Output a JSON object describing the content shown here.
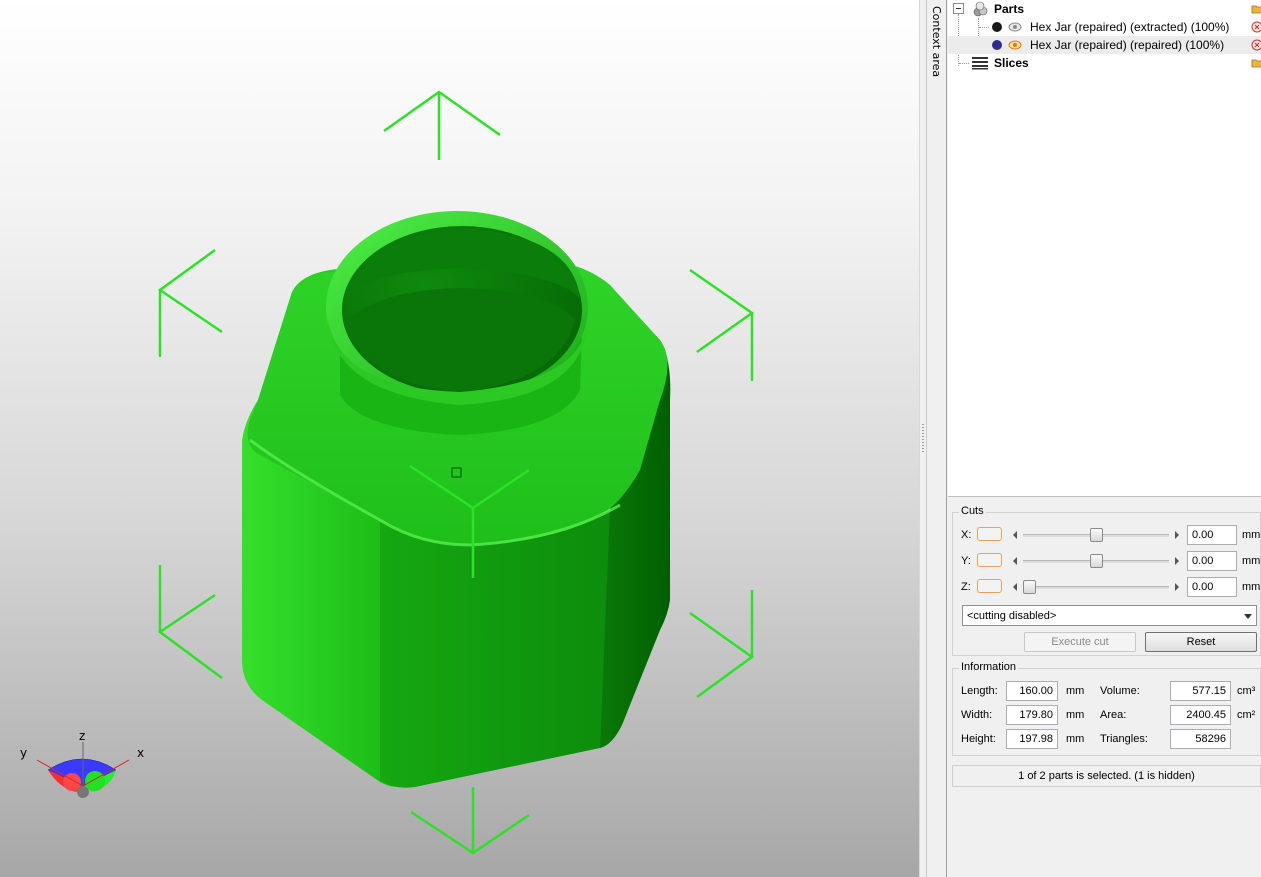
{
  "tree": {
    "parts_label": "Parts",
    "items": [
      {
        "label": "Hex Jar (repaired) (extracted) (100%)",
        "color": "#1a1a1a",
        "visible_icon": "eye-hidden-icon"
      },
      {
        "label": "Hex Jar (repaired) (repaired) (100%)",
        "color": "#2e2c8f",
        "visible_icon": "eye-visible-icon"
      }
    ],
    "slices_label": "Slices"
  },
  "context_label": "Context area",
  "viewport": {
    "model_color": "#1fce1a",
    "handle_color": "#22e01e",
    "axis_labels": {
      "x": "x",
      "y": "y",
      "z": "z"
    }
  },
  "cuts": {
    "title": "Cuts",
    "axes": [
      {
        "name": "X:",
        "value": "0.00",
        "unit": "mm",
        "position": 0.5
      },
      {
        "name": "Y:",
        "value": "0.00",
        "unit": "mm",
        "position": 0.5
      },
      {
        "name": "Z:",
        "value": "0.00",
        "unit": "mm",
        "position": 0.0
      }
    ],
    "mode": "<cutting disabled>",
    "execute_label": "Execute cut",
    "reset_label": "Reset"
  },
  "information": {
    "title": "Information",
    "length_label": "Length:",
    "length_value": "160.00",
    "length_unit": "mm",
    "width_label": "Width:",
    "width_value": "179.80",
    "width_unit": "mm",
    "height_label": "Height:",
    "height_value": "197.98",
    "height_unit": "mm",
    "volume_label": "Volume:",
    "volume_value": "577.15",
    "volume_unit": "cm³",
    "area_label": "Area:",
    "area_value": "2400.45",
    "area_unit": "cm²",
    "triangles_label": "Triangles:",
    "triangles_value": "58296"
  },
  "status": "1 of 2 parts is selected. (1 is hidden)"
}
